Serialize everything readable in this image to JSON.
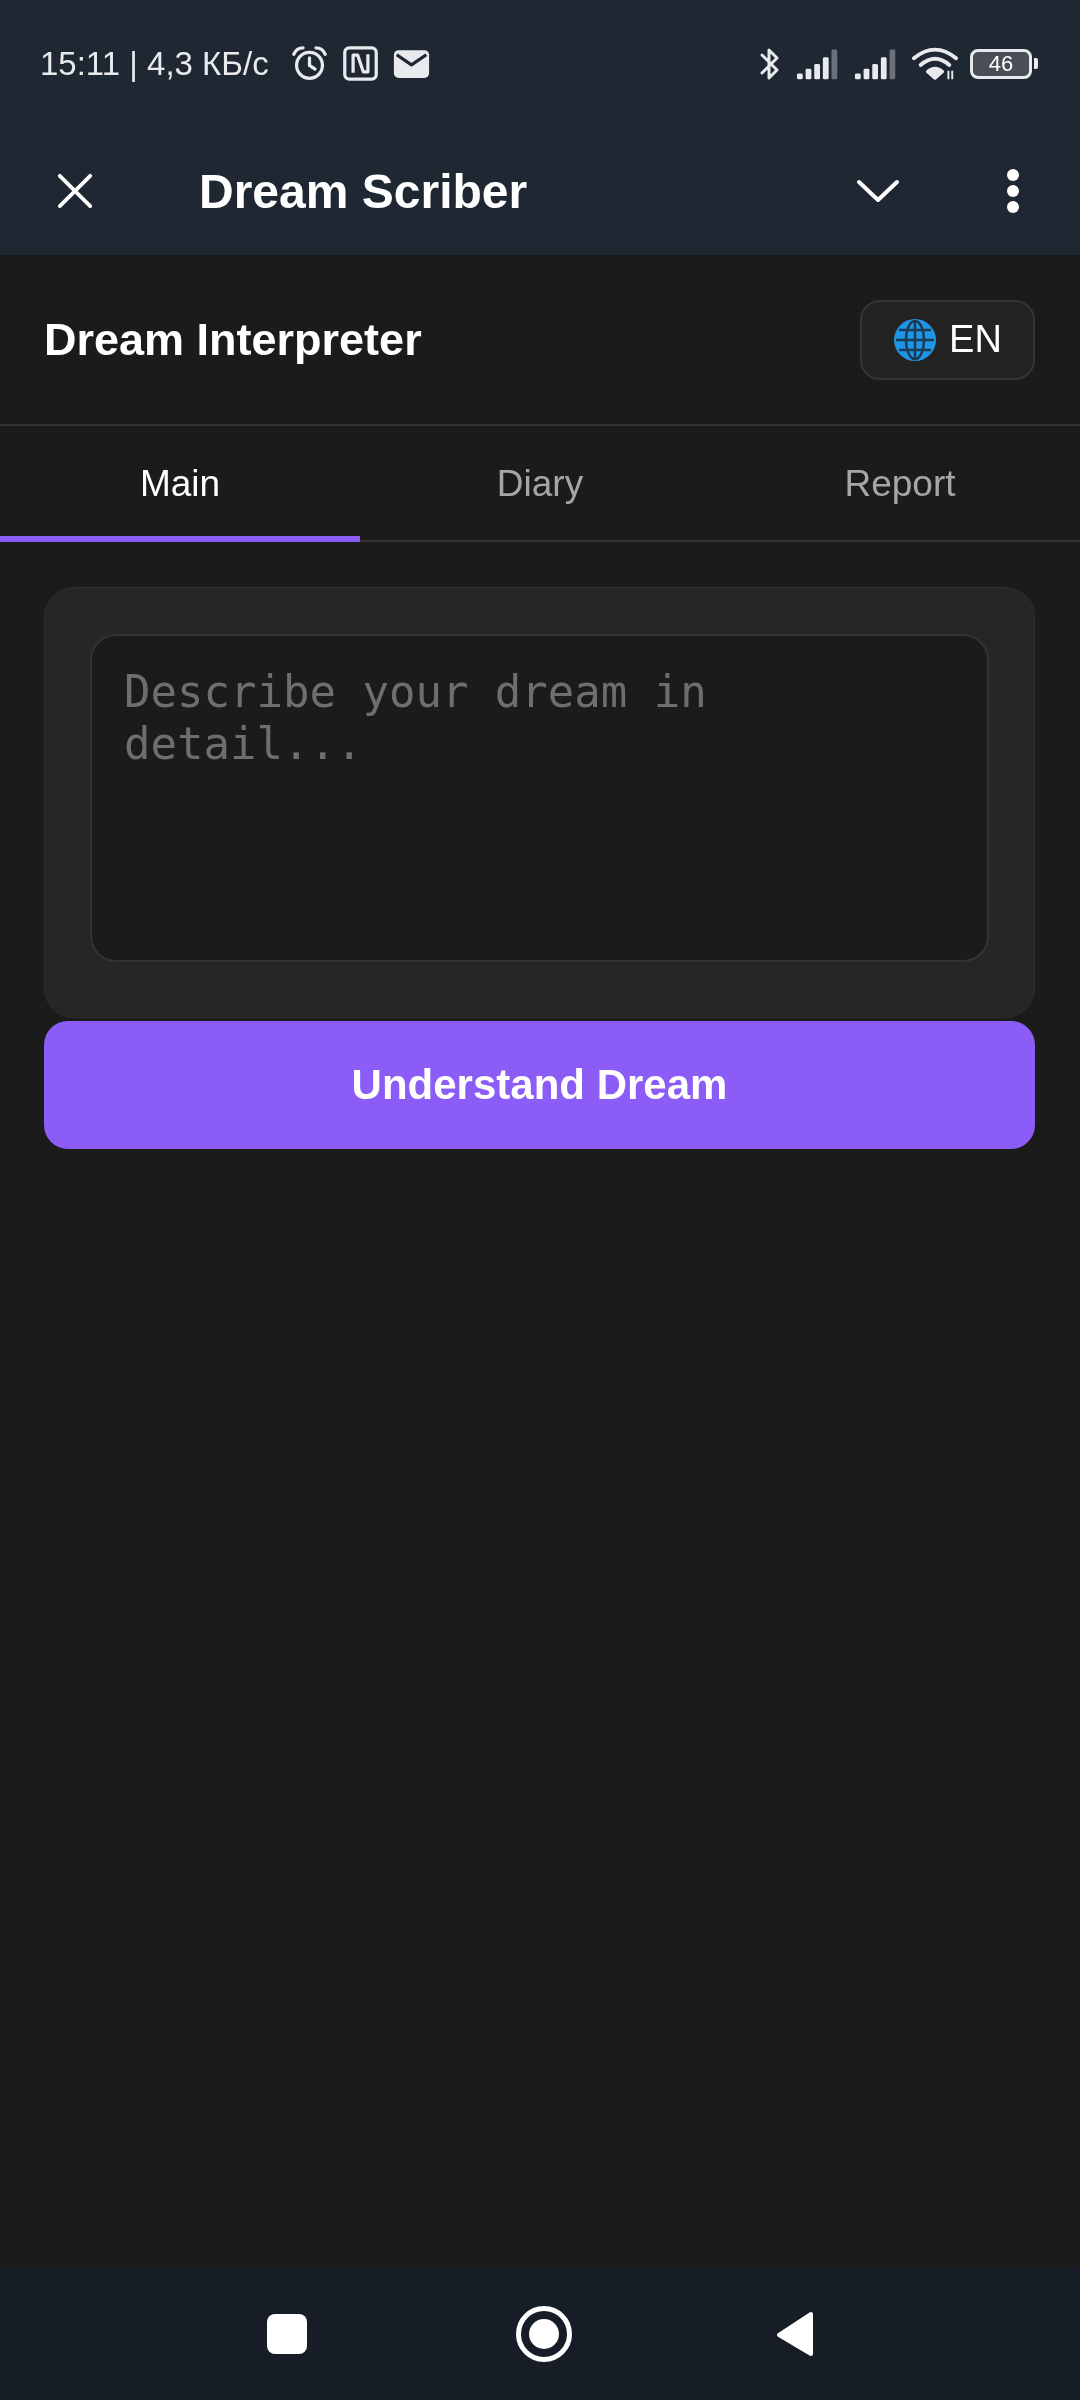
{
  "status_bar": {
    "time_speed": "15:11 | 4,3 КБ/с",
    "battery": "46"
  },
  "header": {
    "title": "Dream Scriber"
  },
  "page": {
    "title": "Dream Interpreter",
    "language": "EN"
  },
  "tabs": [
    {
      "label": "Main",
      "selected": true
    },
    {
      "label": "Diary",
      "selected": false
    },
    {
      "label": "Report",
      "selected": false
    }
  ],
  "dream_input": {
    "placeholder": "Describe your dream in detail..."
  },
  "submit_button": {
    "label": "Understand Dream"
  }
}
